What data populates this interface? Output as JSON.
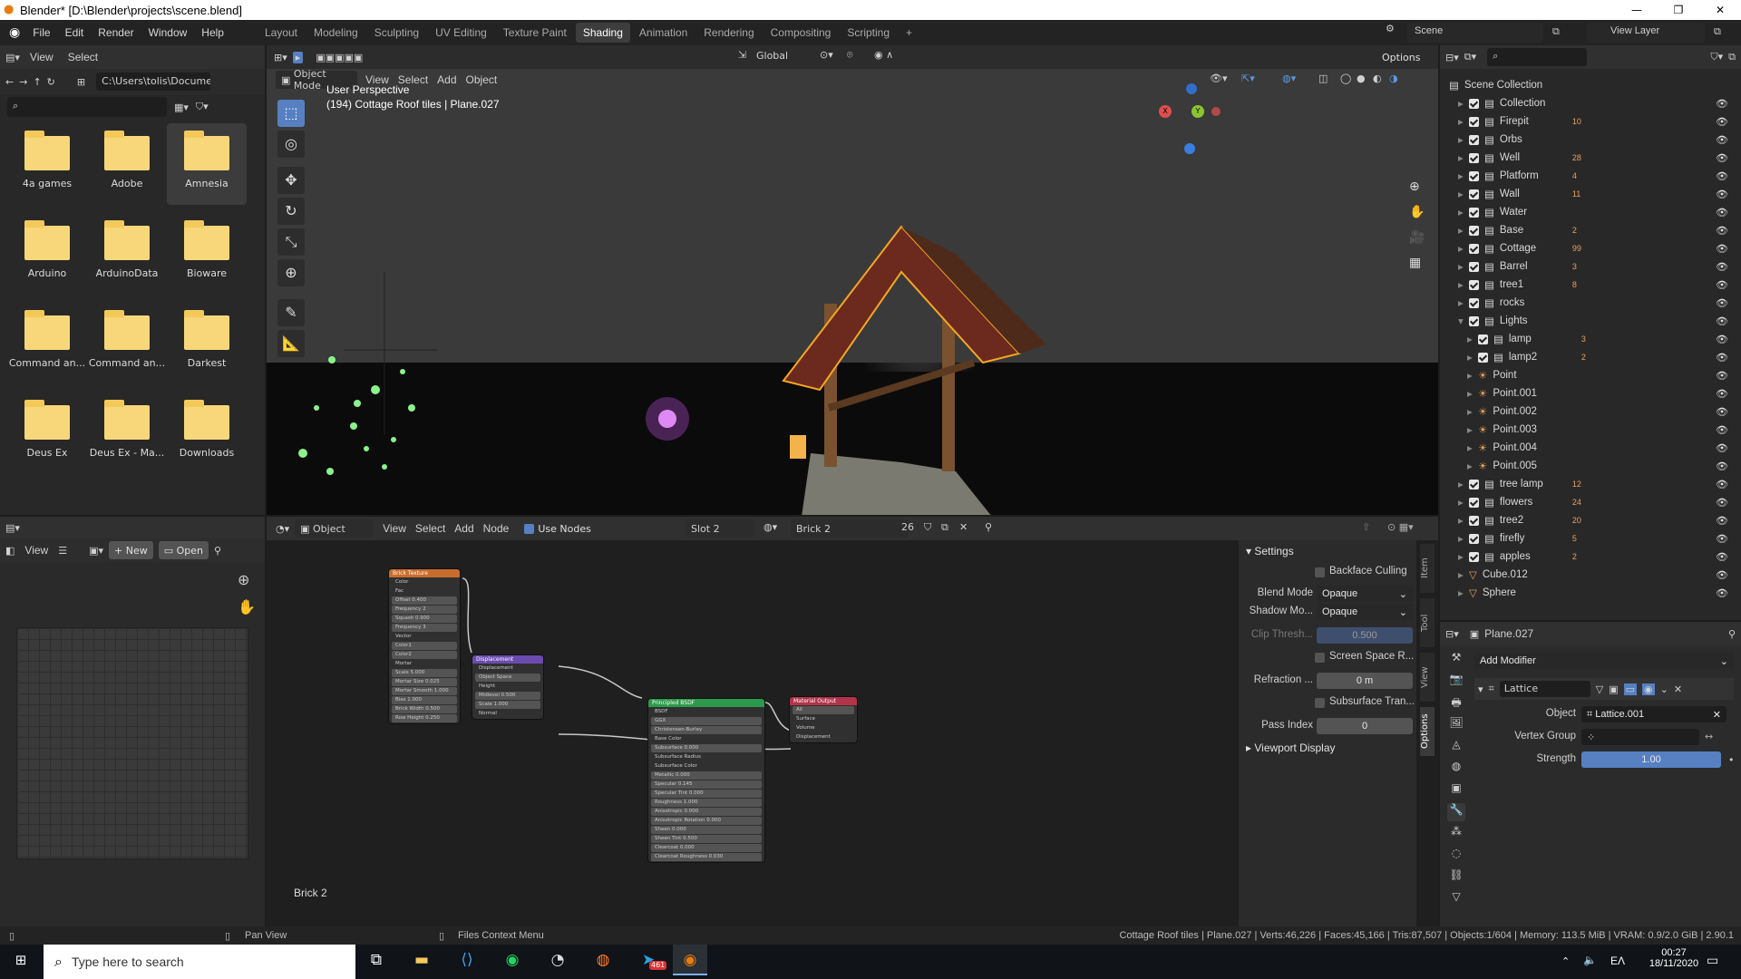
{
  "window": {
    "title": "Blender* [D:\\Blender\\projects\\scene.blend]",
    "minimize": "—",
    "maximize": "❐",
    "close": "✕"
  },
  "topbar": {
    "menus": [
      "File",
      "Edit",
      "Render",
      "Window",
      "Help"
    ],
    "workspaces": [
      "Layout",
      "Modeling",
      "Sculpting",
      "UV Editing",
      "Texture Paint",
      "Shading",
      "Animation",
      "Rendering",
      "Compositing",
      "Scripting"
    ],
    "active_workspace": "Shading",
    "add_tab": "+",
    "scene": "Scene",
    "view_layer": "View Layer"
  },
  "file_browser": {
    "menus": [
      "View",
      "Select"
    ],
    "path": "C:\\Users\\tolis\\Docume...",
    "folders": [
      {
        "name": "4a games",
        "selected": false
      },
      {
        "name": "Adobe",
        "selected": false
      },
      {
        "name": "Amnesia",
        "selected": true
      },
      {
        "name": "Arduino",
        "selected": false
      },
      {
        "name": "ArduinoData",
        "selected": false
      },
      {
        "name": "Bioware",
        "selected": false
      },
      {
        "name": "Command an...",
        "selected": false
      },
      {
        "name": "Command an...",
        "selected": false
      },
      {
        "name": "Darkest",
        "selected": false
      },
      {
        "name": "Deus Ex",
        "selected": false
      },
      {
        "name": "Deus Ex - Ma...",
        "selected": false
      },
      {
        "name": "Downloads",
        "selected": false
      }
    ]
  },
  "image_editor": {
    "view": "View",
    "new": "New",
    "open": "Open"
  },
  "viewport": {
    "mode": "Object Mode",
    "menus": [
      "View",
      "Select",
      "Add",
      "Object"
    ],
    "orientation": "Global",
    "options": "Options",
    "info_line1": "User Perspective",
    "info_line2": "(194) Cottage Roof tiles | Plane.027",
    "gizmo": {
      "x": "X",
      "y": "Y",
      "z": "Z"
    }
  },
  "node_editor": {
    "editor_type": "Object",
    "menus": [
      "View",
      "Select",
      "Add",
      "Node"
    ],
    "use_nodes": "Use Nodes",
    "slot": "Slot 2",
    "material": "Brick 2",
    "users": "26",
    "footer_label": "Brick 2",
    "nodes": {
      "brick": {
        "title": "Brick Texture",
        "rows": [
          "Color",
          "Fac",
          "Offset  0.400",
          "Frequency  2",
          "Squash  0.900",
          "Frequency  3",
          "Vector",
          "Color1",
          "Color2",
          "Mortar",
          "Scale  5.000",
          "Mortar Size  0.025",
          "Mortar Smooth  1.000",
          "Bias  1.000",
          "Brick Width  0.500",
          "Row Height  0.250"
        ]
      },
      "displacement": {
        "title": "Displacement",
        "rows": [
          "Displacement",
          "Object Space",
          "Height",
          "Midlevel  0.500",
          "Scale  1.000",
          "Normal"
        ]
      },
      "principled": {
        "title": "Principled BSDF",
        "rows": [
          "BSDF",
          "GGX",
          "Christensen-Burley",
          "Base Color",
          "Subsurface  0.000",
          "Subsurface Radius",
          "Subsurface Color",
          "Metallic  0.000",
          "Specular  0.145",
          "Specular Tint  0.000",
          "Roughness  1.000",
          "Anisotropic  0.000",
          "Anisotropic Rotation  0.000",
          "Sheen  0.000",
          "Sheen Tint  0.500",
          "Clearcoat  0.000",
          "Clearcoat Roughness  0.030"
        ]
      },
      "output": {
        "title": "Material Output",
        "rows": [
          "All",
          "Surface",
          "Volume",
          "Displacement"
        ]
      }
    },
    "side_tabs": [
      "Item",
      "Tool",
      "View",
      "Options"
    ]
  },
  "settings_panel": {
    "header": "Settings",
    "backface_culling": "Backface Culling",
    "blend_mode_label": "Blend Mode",
    "blend_mode": "Opaque",
    "shadow_mode_label": "Shadow Mo...",
    "shadow_mode": "Opaque",
    "clip_label": "Clip Thresh...",
    "clip_value": "0.500",
    "ssr": "Screen Space R...",
    "refraction_label": "Refraction ...",
    "refraction_value": "0 m",
    "sss": "Subsurface Tran...",
    "pass_label": "Pass Index",
    "pass_value": "0",
    "viewport_display": "Viewport Display"
  },
  "outliner": {
    "root": "Scene Collection",
    "items": [
      {
        "name": "Collection",
        "indent": 1,
        "kind": "collection",
        "badge": ""
      },
      {
        "name": "Firepit",
        "indent": 1,
        "kind": "collection",
        "badge": "10"
      },
      {
        "name": "Orbs",
        "indent": 1,
        "kind": "collection",
        "badge": ""
      },
      {
        "name": "Well",
        "indent": 1,
        "kind": "collection",
        "badge": "28"
      },
      {
        "name": "Platform",
        "indent": 1,
        "kind": "collection",
        "badge": "4"
      },
      {
        "name": "Wall",
        "indent": 1,
        "kind": "collection",
        "badge": "11"
      },
      {
        "name": "Water",
        "indent": 1,
        "kind": "collection",
        "badge": ""
      },
      {
        "name": "Base",
        "indent": 1,
        "kind": "collection",
        "badge": "2"
      },
      {
        "name": "Cottage",
        "indent": 1,
        "kind": "collection",
        "badge": "99"
      },
      {
        "name": "Barrel",
        "indent": 1,
        "kind": "collection",
        "badge": "3"
      },
      {
        "name": "tree1",
        "indent": 1,
        "kind": "collection",
        "badge": "8"
      },
      {
        "name": "rocks",
        "indent": 1,
        "kind": "collection",
        "badge": ""
      },
      {
        "name": "Lights",
        "indent": 1,
        "kind": "collection",
        "badge": ""
      },
      {
        "name": "lamp",
        "indent": 2,
        "kind": "collection",
        "badge": "3"
      },
      {
        "name": "lamp2",
        "indent": 2,
        "kind": "collection",
        "badge": "2"
      },
      {
        "name": "Point",
        "indent": 2,
        "kind": "light",
        "badge": ""
      },
      {
        "name": "Point.001",
        "indent": 2,
        "kind": "light",
        "badge": ""
      },
      {
        "name": "Point.002",
        "indent": 2,
        "kind": "light",
        "badge": ""
      },
      {
        "name": "Point.003",
        "indent": 2,
        "kind": "light",
        "badge": ""
      },
      {
        "name": "Point.004",
        "indent": 2,
        "kind": "light",
        "badge": ""
      },
      {
        "name": "Point.005",
        "indent": 2,
        "kind": "light",
        "badge": ""
      },
      {
        "name": "tree lamp",
        "indent": 1,
        "kind": "collection",
        "badge": "12"
      },
      {
        "name": "flowers",
        "indent": 1,
        "kind": "collection",
        "badge": "24"
      },
      {
        "name": "tree2",
        "indent": 1,
        "kind": "collection",
        "badge": "20"
      },
      {
        "name": "firefly",
        "indent": 1,
        "kind": "collection",
        "badge": "5"
      },
      {
        "name": "apples",
        "indent": 1,
        "kind": "collection",
        "badge": "2"
      },
      {
        "name": "Cube.012",
        "indent": 1,
        "kind": "object",
        "badge": ""
      },
      {
        "name": "Sphere",
        "indent": 1,
        "kind": "object",
        "badge": ""
      }
    ]
  },
  "properties": {
    "object_name": "Plane.027",
    "add_modifier": "Add Modifier",
    "modifier_name": "Lattice",
    "object_label": "Object",
    "object_value": "Lattice.001",
    "vgroup_label": "Vertex Group",
    "strength_label": "Strength",
    "strength_value": "1.00",
    "strength_fraction": 1.0
  },
  "statusbar": {
    "left": "Pan View",
    "middle": "Files Context Menu",
    "right": "Cottage Roof tiles | Plane.027 | Verts:46,226 | Faces:45,166 | Tris:87,507 | Objects:1/604 | Memory: 113.5 MiB | VRAM: 0.9/2.0 GiB | 2.90.1"
  },
  "taskbar": {
    "search_placeholder": "Type here to search",
    "lang": "ΕΛ",
    "time": "00:27",
    "date": "18/11/2020",
    "telegram_badge": "461"
  },
  "colors": {
    "accent": "#5680c2",
    "orange_select": "#f5a623",
    "folder": "#f7d779"
  }
}
